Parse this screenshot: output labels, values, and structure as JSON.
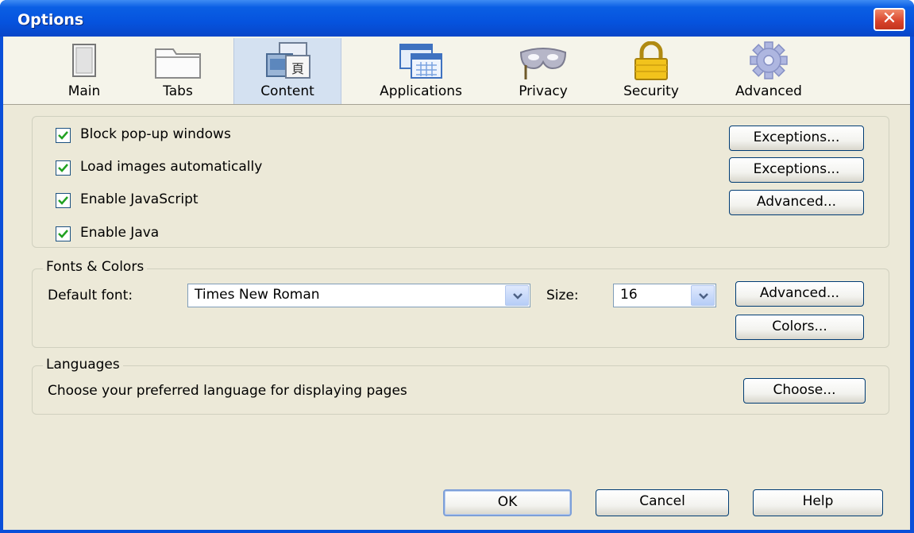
{
  "window": {
    "title": "Options",
    "close_symbol": "✕"
  },
  "toolbar": {
    "tabs": [
      {
        "label": "Main",
        "icon": "main-window-icon"
      },
      {
        "label": "Tabs",
        "icon": "tabs-icon"
      },
      {
        "label": "Content",
        "icon": "content-icon",
        "selected": true
      },
      {
        "label": "Applications",
        "icon": "applications-icon"
      },
      {
        "label": "Privacy",
        "icon": "mask-icon"
      },
      {
        "label": "Security",
        "icon": "padlock-icon"
      },
      {
        "label": "Advanced",
        "icon": "gear-icon"
      }
    ]
  },
  "content": {
    "block_popups": {
      "label": "Block pop-up windows",
      "checked": true
    },
    "load_images": {
      "label": "Load images automatically",
      "checked": true
    },
    "enable_js": {
      "label": "Enable JavaScript",
      "checked": true
    },
    "enable_java": {
      "label": "Enable Java",
      "checked": true
    },
    "exceptions1_label": "Exceptions...",
    "exceptions2_label": "Exceptions...",
    "advanced_js_label": "Advanced..."
  },
  "fonts": {
    "legend": "Fonts & Colors",
    "default_font_label": "Default font:",
    "default_font_value": "Times New Roman",
    "size_label": "Size:",
    "size_value": "16",
    "advanced_label": "Advanced...",
    "colors_label": "Colors..."
  },
  "languages": {
    "legend": "Languages",
    "description": "Choose your preferred language for displaying pages",
    "choose_label": "Choose..."
  },
  "footer": {
    "ok_label": "OK",
    "cancel_label": "Cancel",
    "help_label": "Help"
  },
  "colors": {
    "titlebar": "#0a53de",
    "selected_tab": "#d4e1f1",
    "check": "#21a121"
  }
}
